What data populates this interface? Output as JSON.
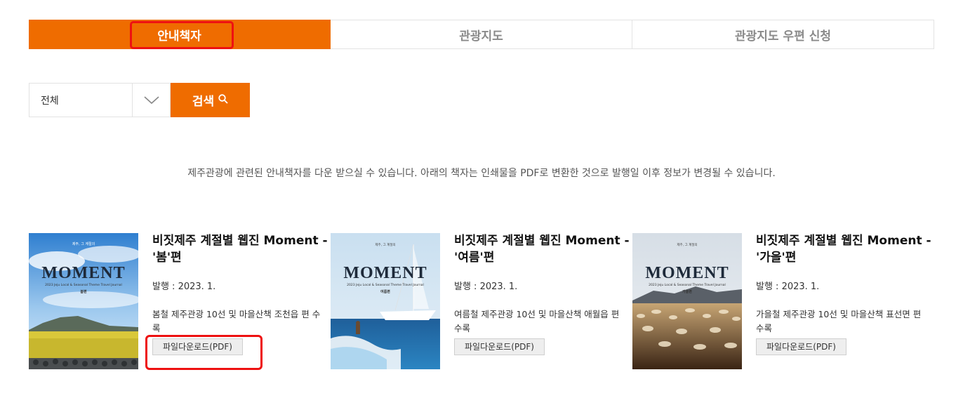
{
  "tabs": [
    {
      "label": "안내책자",
      "active": true
    },
    {
      "label": "관광지도",
      "active": false
    },
    {
      "label": "관광지도 우편 신청",
      "active": false
    }
  ],
  "search": {
    "select_value": "전체",
    "button_label": "검색",
    "icon": "search-icon"
  },
  "notice": "제주관광에 관련된 안내책자를 다운 받으실 수 있습니다. 아래의 책자는 인쇄물을 PDF로 변환한 것으로 발행일 이후 정보가 변경될 수 있습니다.",
  "books": [
    {
      "title": "비짓제주 계절별 웹진 Moment - '봄'편",
      "date": "발행 : 2023. 1.",
      "desc": "봄철 제주관광 10선 및 마을산책 조천읍 편 수록",
      "download": "파일다운로드(PDF)",
      "cover": {
        "tagline": "제주, 그 계절의",
        "word": "MOMENT",
        "sub": "2023 Jeju Local & Seasonal Theme Travel Journal",
        "season": "봄편"
      }
    },
    {
      "title": "비짓제주 계절별 웹진 Moment - '여름'편",
      "date": "발행 : 2023. 1.",
      "desc": "여름철 제주관광 10선 및 마을산책 애월읍 편 수록",
      "download": "파일다운로드(PDF)",
      "cover": {
        "tagline": "제주, 그 계절의",
        "word": "MOMENT",
        "sub": "2023 Jeju Local & Seasonal Theme Travel Journal",
        "season": "여름편"
      }
    },
    {
      "title": "비짓제주 계절별 웹진 Moment - '가을'편",
      "date": "발행 : 2023. 1.",
      "desc": "가을철 제주관광 10선 및 마을산책 표선면 편 수록",
      "download": "파일다운로드(PDF)",
      "cover": {
        "tagline": "제주, 그 계절의",
        "word": "MOMENT",
        "sub": "2023 Jeju Local & Seasonal Theme Travel Journal",
        "season": "가을편"
      }
    }
  ],
  "colors": {
    "accent": "#ef6c00",
    "highlight": "#ee1111"
  }
}
